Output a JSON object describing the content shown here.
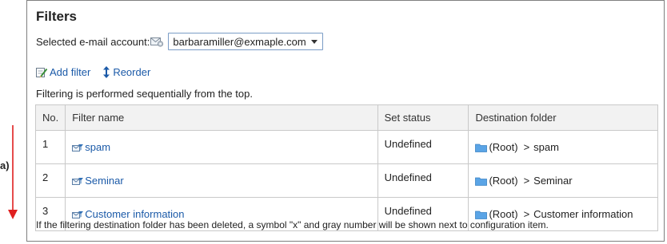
{
  "panel": {
    "title": "Filters",
    "account_label": "Selected e-mail account:",
    "account_value": "barbaramiller@exmaple.com",
    "actions": {
      "add_filter": "Add filter",
      "reorder": "Reorder"
    },
    "sequential_note": "Filtering is performed sequentially from the top.",
    "table": {
      "headers": [
        "No.",
        "Filter name",
        "Set status",
        "Destination folder"
      ],
      "rows": [
        {
          "no": "1",
          "name": "spam",
          "status": "Undefined",
          "root": "(Root)",
          "sep": ">",
          "dest": "spam"
        },
        {
          "no": "2",
          "name": "Seminar",
          "status": "Undefined",
          "root": "(Root)",
          "sep": ">",
          "dest": "Seminar"
        },
        {
          "no": "3",
          "name": "Customer information",
          "status": "Undefined",
          "root": "(Root)",
          "sep": ">",
          "dest": "Customer information"
        }
      ]
    },
    "deleted_note": "If the filtering destination folder has been deleted, a symbol \"x\" and gray number will be shown next to configuration item."
  },
  "annotation": {
    "label": "a)",
    "arrow_color": "#e02020"
  },
  "colors": {
    "link": "#1b5aa8",
    "folder": "#5aa4e6",
    "header_bg": "#f2f2f2"
  },
  "icons": [
    "mail-account-icon",
    "add-filter-icon",
    "reorder-icon",
    "filter-icon",
    "folder-icon"
  ]
}
